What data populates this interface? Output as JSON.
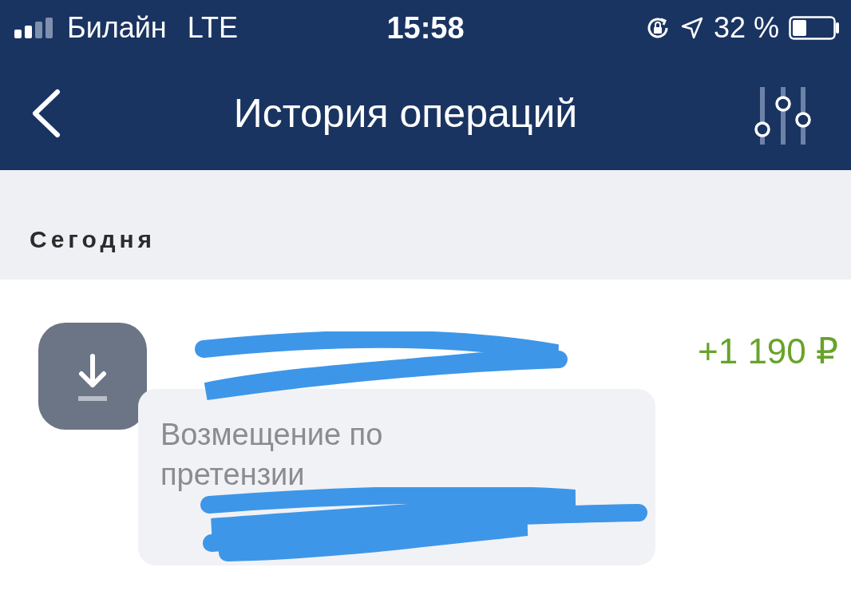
{
  "status_bar": {
    "carrier": "Билайн",
    "network": "LTE",
    "time": "15:58",
    "battery_percent": "32 %"
  },
  "nav_bar": {
    "title": "История операций"
  },
  "section": {
    "title": "Сегодня"
  },
  "operations": [
    {
      "kind": "incoming",
      "amount": "+1 190 ₽",
      "comment": "Возмещение по претензии"
    }
  ]
}
